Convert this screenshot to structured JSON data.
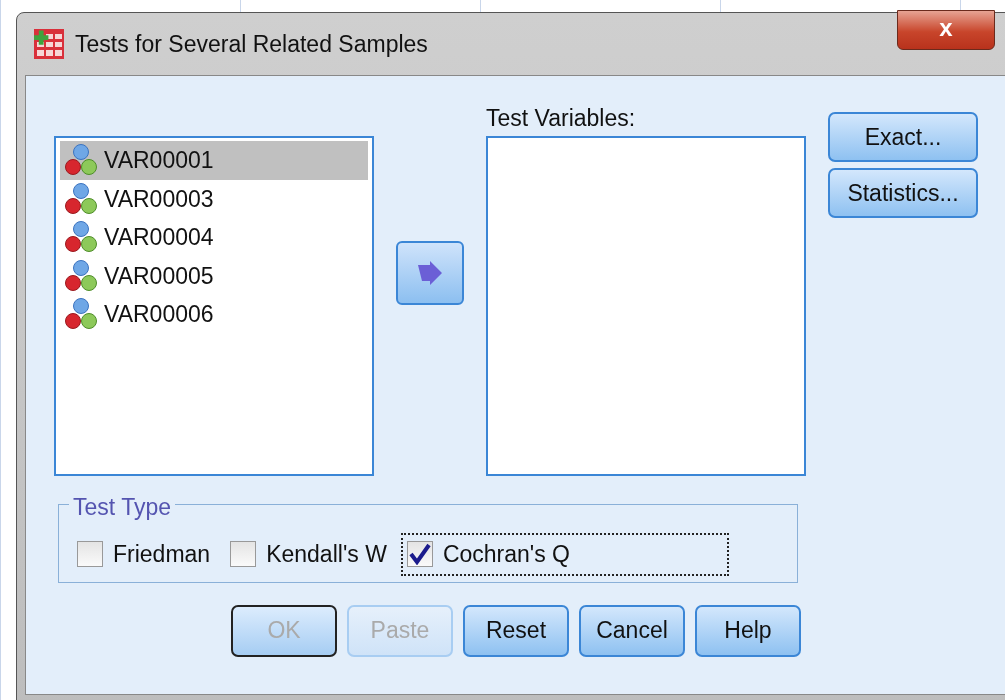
{
  "window": {
    "title": "Tests for Several Related Samples",
    "close": "x"
  },
  "source_list": {
    "items": [
      {
        "label": "VAR00001",
        "selected": true
      },
      {
        "label": "VAR00003",
        "selected": false
      },
      {
        "label": "VAR00004",
        "selected": false
      },
      {
        "label": "VAR00005",
        "selected": false
      },
      {
        "label": "VAR00006",
        "selected": false
      }
    ]
  },
  "test_variables": {
    "label": "Test Variables:"
  },
  "side_buttons": [
    {
      "label": "Exact...",
      "disabled": false
    },
    {
      "label": "Statistics...",
      "disabled": false
    }
  ],
  "test_type": {
    "legend": "Test Type",
    "options": [
      {
        "label": "Friedman",
        "checked": false,
        "focused": false
      },
      {
        "label": "Kendall's W",
        "checked": false,
        "focused": false
      },
      {
        "label": "Cochran's Q",
        "checked": true,
        "focused": true
      }
    ]
  },
  "buttons": [
    {
      "label": "OK",
      "disabled": true,
      "default": true
    },
    {
      "label": "Paste",
      "disabled": true,
      "default": false
    },
    {
      "label": "Reset",
      "disabled": false,
      "default": false
    },
    {
      "label": "Cancel",
      "disabled": false,
      "default": false
    },
    {
      "label": "Help",
      "disabled": false,
      "default": false
    }
  ]
}
